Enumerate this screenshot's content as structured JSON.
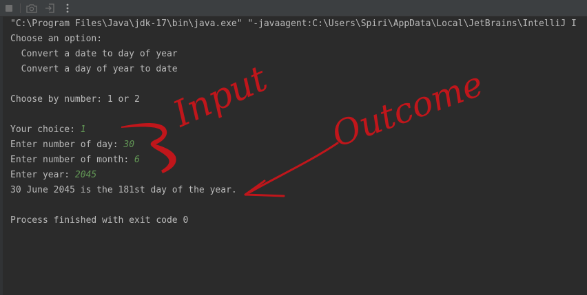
{
  "toolbar": {
    "icons": [
      "stop-icon",
      "camera-icon",
      "login-icon",
      "more-vertical-icon"
    ]
  },
  "console": {
    "command_line": "\"C:\\Program Files\\Java\\jdk-17\\bin\\java.exe\" \"-javaagent:C:\\Users\\Spiri\\AppData\\Local\\JetBrains\\IntelliJ I",
    "menu_prompt": "Choose an option:",
    "option_1": "  Convert a date to day of year",
    "option_2": "  Convert a day of year to date",
    "choose_prompt": "Choose by number: 1 or 2",
    "choice_label": "Your choice: ",
    "choice_value": "1",
    "day_label": "Enter number of day: ",
    "day_value": "30",
    "month_label": "Enter number of month: ",
    "month_value": "6",
    "year_label": "Enter year: ",
    "year_value": "2045",
    "result": "30 June 2045 is the 181st day of the year.",
    "exit_message": "Process finished with exit code 0"
  },
  "annotations": {
    "input_label": "Input",
    "outcome_label": "Outcome",
    "color": "#c0161b"
  },
  "colors": {
    "background": "#2b2b2b",
    "text": "#bbbbbb",
    "user_input": "#629755",
    "toolbar": "#3c3f41"
  }
}
